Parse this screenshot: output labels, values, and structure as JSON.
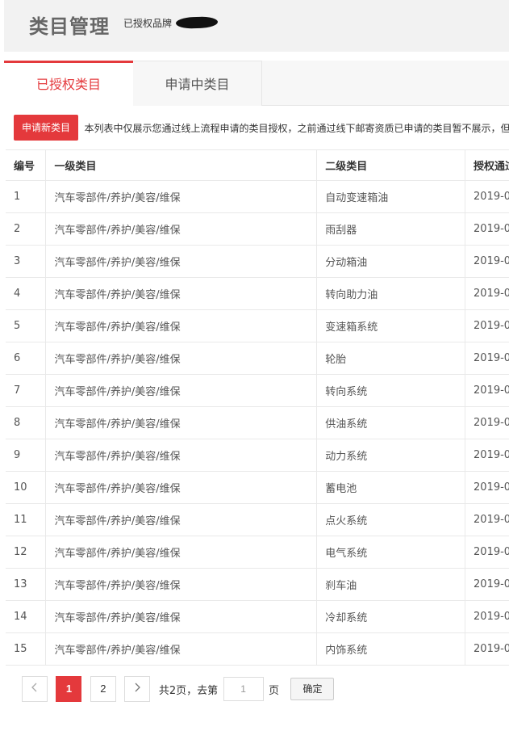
{
  "header": {
    "title": "类目管理",
    "brand_label": "已授权品牌"
  },
  "tabs": [
    {
      "label": "已授权类目",
      "active": true
    },
    {
      "label": "申请中类目",
      "active": false
    }
  ],
  "toolbar": {
    "apply_label": "申请新类目",
    "notice": "本列表中仅展示您通过线上流程申请的类目授权，之前通过线下邮寄资质已申请的类目暂不展示，但"
  },
  "table": {
    "columns": [
      "编号",
      "一级类目",
      "二级类目",
      "授权通过"
    ],
    "rows": [
      {
        "id": "1",
        "level1": "汽车零部件/养护/美容/维保",
        "level2": "自动变速箱油",
        "date": "2019-0"
      },
      {
        "id": "2",
        "level1": "汽车零部件/养护/美容/维保",
        "level2": "雨刮器",
        "date": "2019-0"
      },
      {
        "id": "3",
        "level1": "汽车零部件/养护/美容/维保",
        "level2": "分动箱油",
        "date": "2019-0"
      },
      {
        "id": "4",
        "level1": "汽车零部件/养护/美容/维保",
        "level2": "转向助力油",
        "date": "2019-0"
      },
      {
        "id": "5",
        "level1": "汽车零部件/养护/美容/维保",
        "level2": "变速箱系统",
        "date": "2019-0"
      },
      {
        "id": "6",
        "level1": "汽车零部件/养护/美容/维保",
        "level2": "轮胎",
        "date": "2019-0"
      },
      {
        "id": "7",
        "level1": "汽车零部件/养护/美容/维保",
        "level2": "转向系统",
        "date": "2019-0"
      },
      {
        "id": "8",
        "level1": "汽车零部件/养护/美容/维保",
        "level2": "供油系统",
        "date": "2019-0"
      },
      {
        "id": "9",
        "level1": "汽车零部件/养护/美容/维保",
        "level2": "动力系统",
        "date": "2019-0"
      },
      {
        "id": "10",
        "level1": "汽车零部件/养护/美容/维保",
        "level2": "蓄电池",
        "date": "2019-0"
      },
      {
        "id": "11",
        "level1": "汽车零部件/养护/美容/维保",
        "level2": "点火系统",
        "date": "2019-0"
      },
      {
        "id": "12",
        "level1": "汽车零部件/养护/美容/维保",
        "level2": "电气系统",
        "date": "2019-0"
      },
      {
        "id": "13",
        "level1": "汽车零部件/养护/美容/维保",
        "level2": "刹车油",
        "date": "2019-0"
      },
      {
        "id": "14",
        "level1": "汽车零部件/养护/美容/维保",
        "level2": "冷却系统",
        "date": "2019-0"
      },
      {
        "id": "15",
        "level1": "汽车零部件/养护/美容/维保",
        "level2": "内饰系统",
        "date": "2019-0"
      }
    ]
  },
  "pager": {
    "prev_icon": "chevron-left-icon",
    "next_icon": "chevron-right-icon",
    "pages": [
      "1",
      "2"
    ],
    "current_page": "1",
    "total_text": "共2页，去第",
    "page_suffix": "页",
    "input_value": "1",
    "confirm_label": "确定"
  },
  "colors": {
    "accent": "#e4393c",
    "header_bg": "#f2f2f2"
  }
}
